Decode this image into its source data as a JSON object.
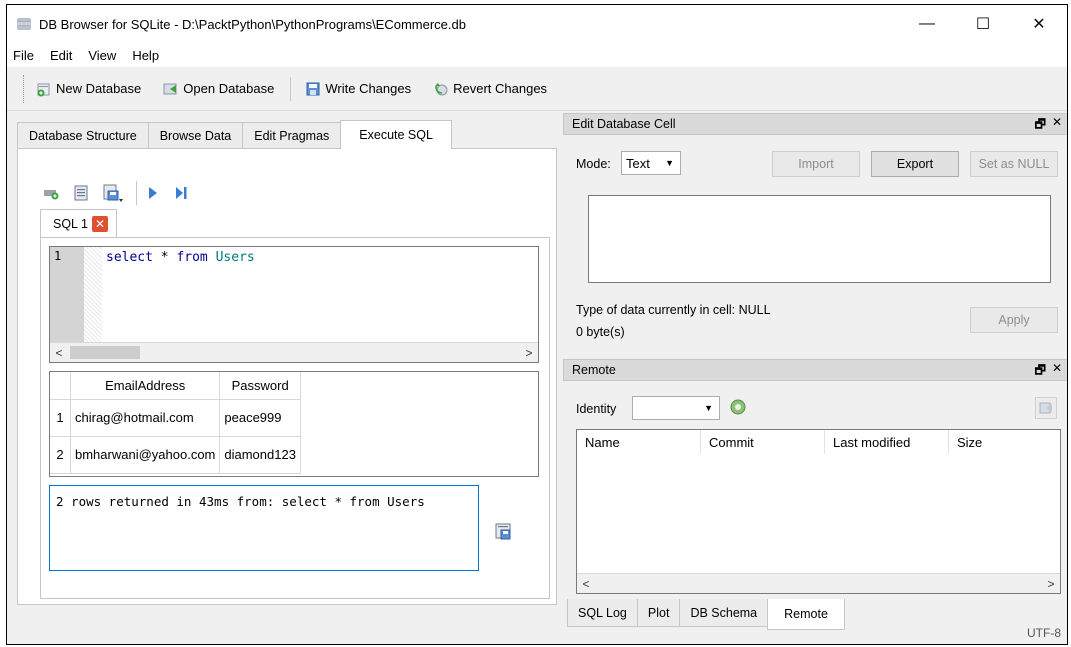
{
  "window": {
    "title": "DB Browser for SQLite - D:\\PacktPython\\PythonPrograms\\ECommerce.db",
    "minimize": "—",
    "maximize": "☐",
    "close": "✕"
  },
  "menu": {
    "file": "File",
    "edit": "Edit",
    "view": "View",
    "help": "Help"
  },
  "toolbar": {
    "new_database": "New Database",
    "open_database": "Open Database",
    "write_changes": "Write Changes",
    "revert_changes": "Revert Changes"
  },
  "tabs": {
    "database_structure": "Database Structure",
    "browse_data": "Browse Data",
    "edit_pragmas": "Edit Pragmas",
    "execute_sql": "Execute SQL"
  },
  "sql_editor": {
    "tab_label": "SQL 1",
    "tab_close": "✕",
    "line_number": "1",
    "code": {
      "kw1": "select",
      "star": " * ",
      "kw2": "from",
      "sp": " ",
      "table": "Users"
    },
    "scroll_left": "<",
    "scroll_right": ">"
  },
  "results": {
    "columns": [
      "EmailAddress",
      "Password"
    ],
    "rows": [
      {
        "num": "1",
        "email": "chirag@hotmail.com",
        "password": "peace999"
      },
      {
        "num": "2",
        "email": "bmharwani@yahoo.com",
        "password": "diamond123"
      }
    ]
  },
  "message": "2 rows returned in 43ms from: select * from Users",
  "edit_cell": {
    "title": "Edit Database Cell",
    "mode_label": "Mode:",
    "mode_value": "Text",
    "import": "Import",
    "export": "Export",
    "set_null": "Set as NULL",
    "type_info": "Type of data currently in cell: NULL",
    "size_info": "0 byte(s)",
    "apply": "Apply",
    "dock_float": "🗗",
    "dock_close": "✕"
  },
  "remote": {
    "title": "Remote",
    "identity_label": "Identity",
    "columns": [
      "Name",
      "Commit",
      "Last modified",
      "Size"
    ],
    "scroll_left": "<",
    "scroll_right": ">",
    "dock_float": "🗗",
    "dock_close": "✕"
  },
  "bottom_tabs": {
    "sql_log": "SQL Log",
    "plot": "Plot",
    "db_schema": "DB Schema",
    "remote": "Remote"
  },
  "status": {
    "encoding": "UTF-8"
  },
  "colors": {
    "accent": "#0078d7",
    "close_red": "#e0502e",
    "keyword": "#00008b",
    "identifier": "#007a7a"
  }
}
